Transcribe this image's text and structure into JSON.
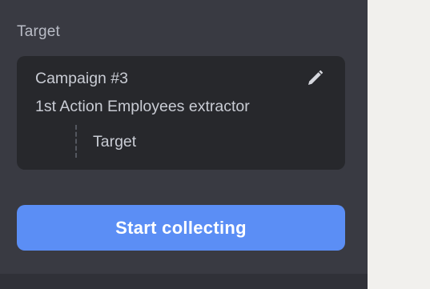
{
  "section": {
    "label": "Target"
  },
  "target_card": {
    "campaign": "Campaign #3",
    "action": "1st Action Employees extractor",
    "step_label": "Target",
    "edit_icon": "pencil-icon"
  },
  "actions": {
    "start_label": "Start collecting"
  },
  "colors": {
    "panel_bg": "#393a42",
    "card_bg": "#27282c",
    "accent": "#5b8ef5",
    "page_bg": "#f1f0ed"
  }
}
